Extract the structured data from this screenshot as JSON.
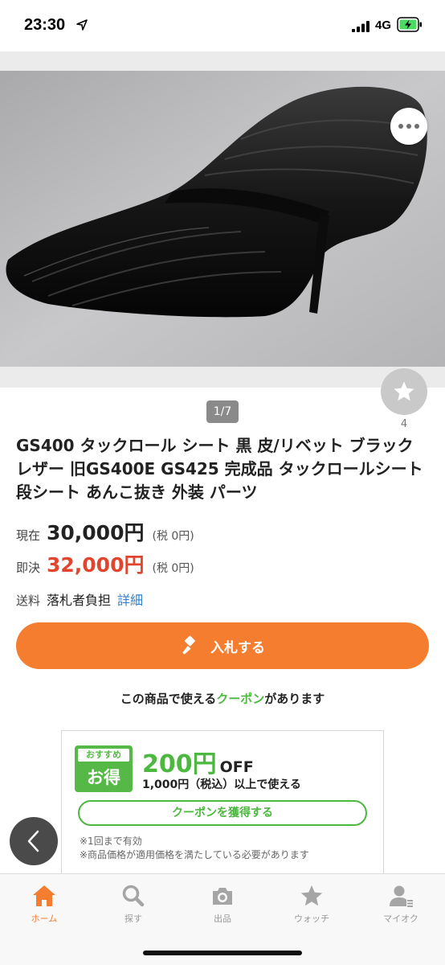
{
  "status_bar": {
    "time": "23:30",
    "network": "4G"
  },
  "gallery": {
    "counter": "1/7",
    "watch_count": "4"
  },
  "product": {
    "title": "GS400 タックロール シート 黒 皮/リベット ブラック レザー 旧GS400E GS425 完成品 タックロールシート 段シート あんこ抜き 外装 パーツ"
  },
  "pricing": {
    "current_label": "現在",
    "current_price": "30,000円",
    "current_tax": "(税 0円)",
    "buynow_label": "即決",
    "buynow_price": "32,000円",
    "buynow_tax": "(税 0円)",
    "shipping_label": "送料",
    "shipping_value": "落札者負担",
    "shipping_link": "詳細"
  },
  "bid_button": {
    "label": "入札する"
  },
  "coupon": {
    "notice_before": "この商品で使える",
    "notice_highlight": "クーポン",
    "notice_after": "があります",
    "badge_top": "おすすめ",
    "badge_main": "お得",
    "amount": "200円",
    "off": "OFF",
    "condition": "1,000円（税込）以上で使える",
    "get_button": "クーポンを獲得する",
    "note1": "※1回まで有効",
    "note2": "※商品価格が適用価格を満たしている必要があります"
  },
  "tab_bar": {
    "tabs": [
      {
        "label": "ホーム",
        "icon": "home-icon"
      },
      {
        "label": "探す",
        "icon": "search-icon"
      },
      {
        "label": "出品",
        "icon": "camera-icon"
      },
      {
        "label": "ウォッチ",
        "icon": "star-icon"
      },
      {
        "label": "マイオク",
        "icon": "user-icon"
      }
    ]
  },
  "colors": {
    "accent_orange": "#f47d2f",
    "price_red": "#e2452e",
    "coupon_green": "#4cb83f",
    "link_blue": "#2f80d0"
  }
}
